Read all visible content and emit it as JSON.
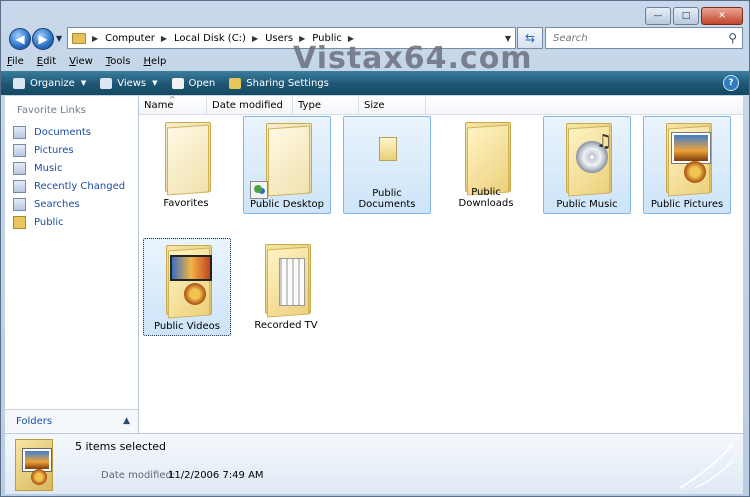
{
  "window": {
    "caption_buttons": {
      "minimize": "—",
      "maximize": "□",
      "close": "✕"
    }
  },
  "navigation": {
    "back_icon": "arrow-left-icon",
    "forward_icon": "arrow-right-icon",
    "breadcrumbs": [
      "Computer",
      "Local Disk (C:)",
      "Users",
      "Public"
    ],
    "search_placeholder": "Search"
  },
  "watermark": "Vistax64.com",
  "menubar": [
    {
      "label": "File",
      "key": "F",
      "rest": "ile"
    },
    {
      "label": "Edit",
      "key": "E",
      "rest": "dit"
    },
    {
      "label": "View",
      "key": "V",
      "rest": "iew"
    },
    {
      "label": "Tools",
      "key": "T",
      "rest": "ools"
    },
    {
      "label": "Help",
      "key": "H",
      "rest": "elp"
    }
  ],
  "commandbar": {
    "organize": "Organize",
    "views": "Views",
    "open": "Open",
    "sharing": "Sharing Settings",
    "help": "?"
  },
  "navpane": {
    "title": "Favorite Links",
    "items": [
      "Documents",
      "Pictures",
      "Music",
      "Recently Changed",
      "Searches",
      "Public"
    ],
    "folders_label": "Folders"
  },
  "columns": [
    "Name",
    "Date modified",
    "Type",
    "Size"
  ],
  "items": [
    {
      "label": "Favorites",
      "selected": false
    },
    {
      "label": "Public Desktop",
      "selected": true
    },
    {
      "label": "Public Documents",
      "selected": true
    },
    {
      "label": "Public Downloads",
      "selected": false
    },
    {
      "label": "Public Music",
      "selected": true
    },
    {
      "label": "Public Pictures",
      "selected": true
    },
    {
      "label": "Public Videos",
      "selected": true
    },
    {
      "label": "Recorded TV",
      "selected": false
    }
  ],
  "details": {
    "title": "5 items selected",
    "date_label": "Date modified:",
    "date_value": "11/2/2006 7:49 AM"
  },
  "colors": {
    "accent": "#1d5674",
    "link": "#1a4ea1",
    "selection": "#cde4f8"
  }
}
